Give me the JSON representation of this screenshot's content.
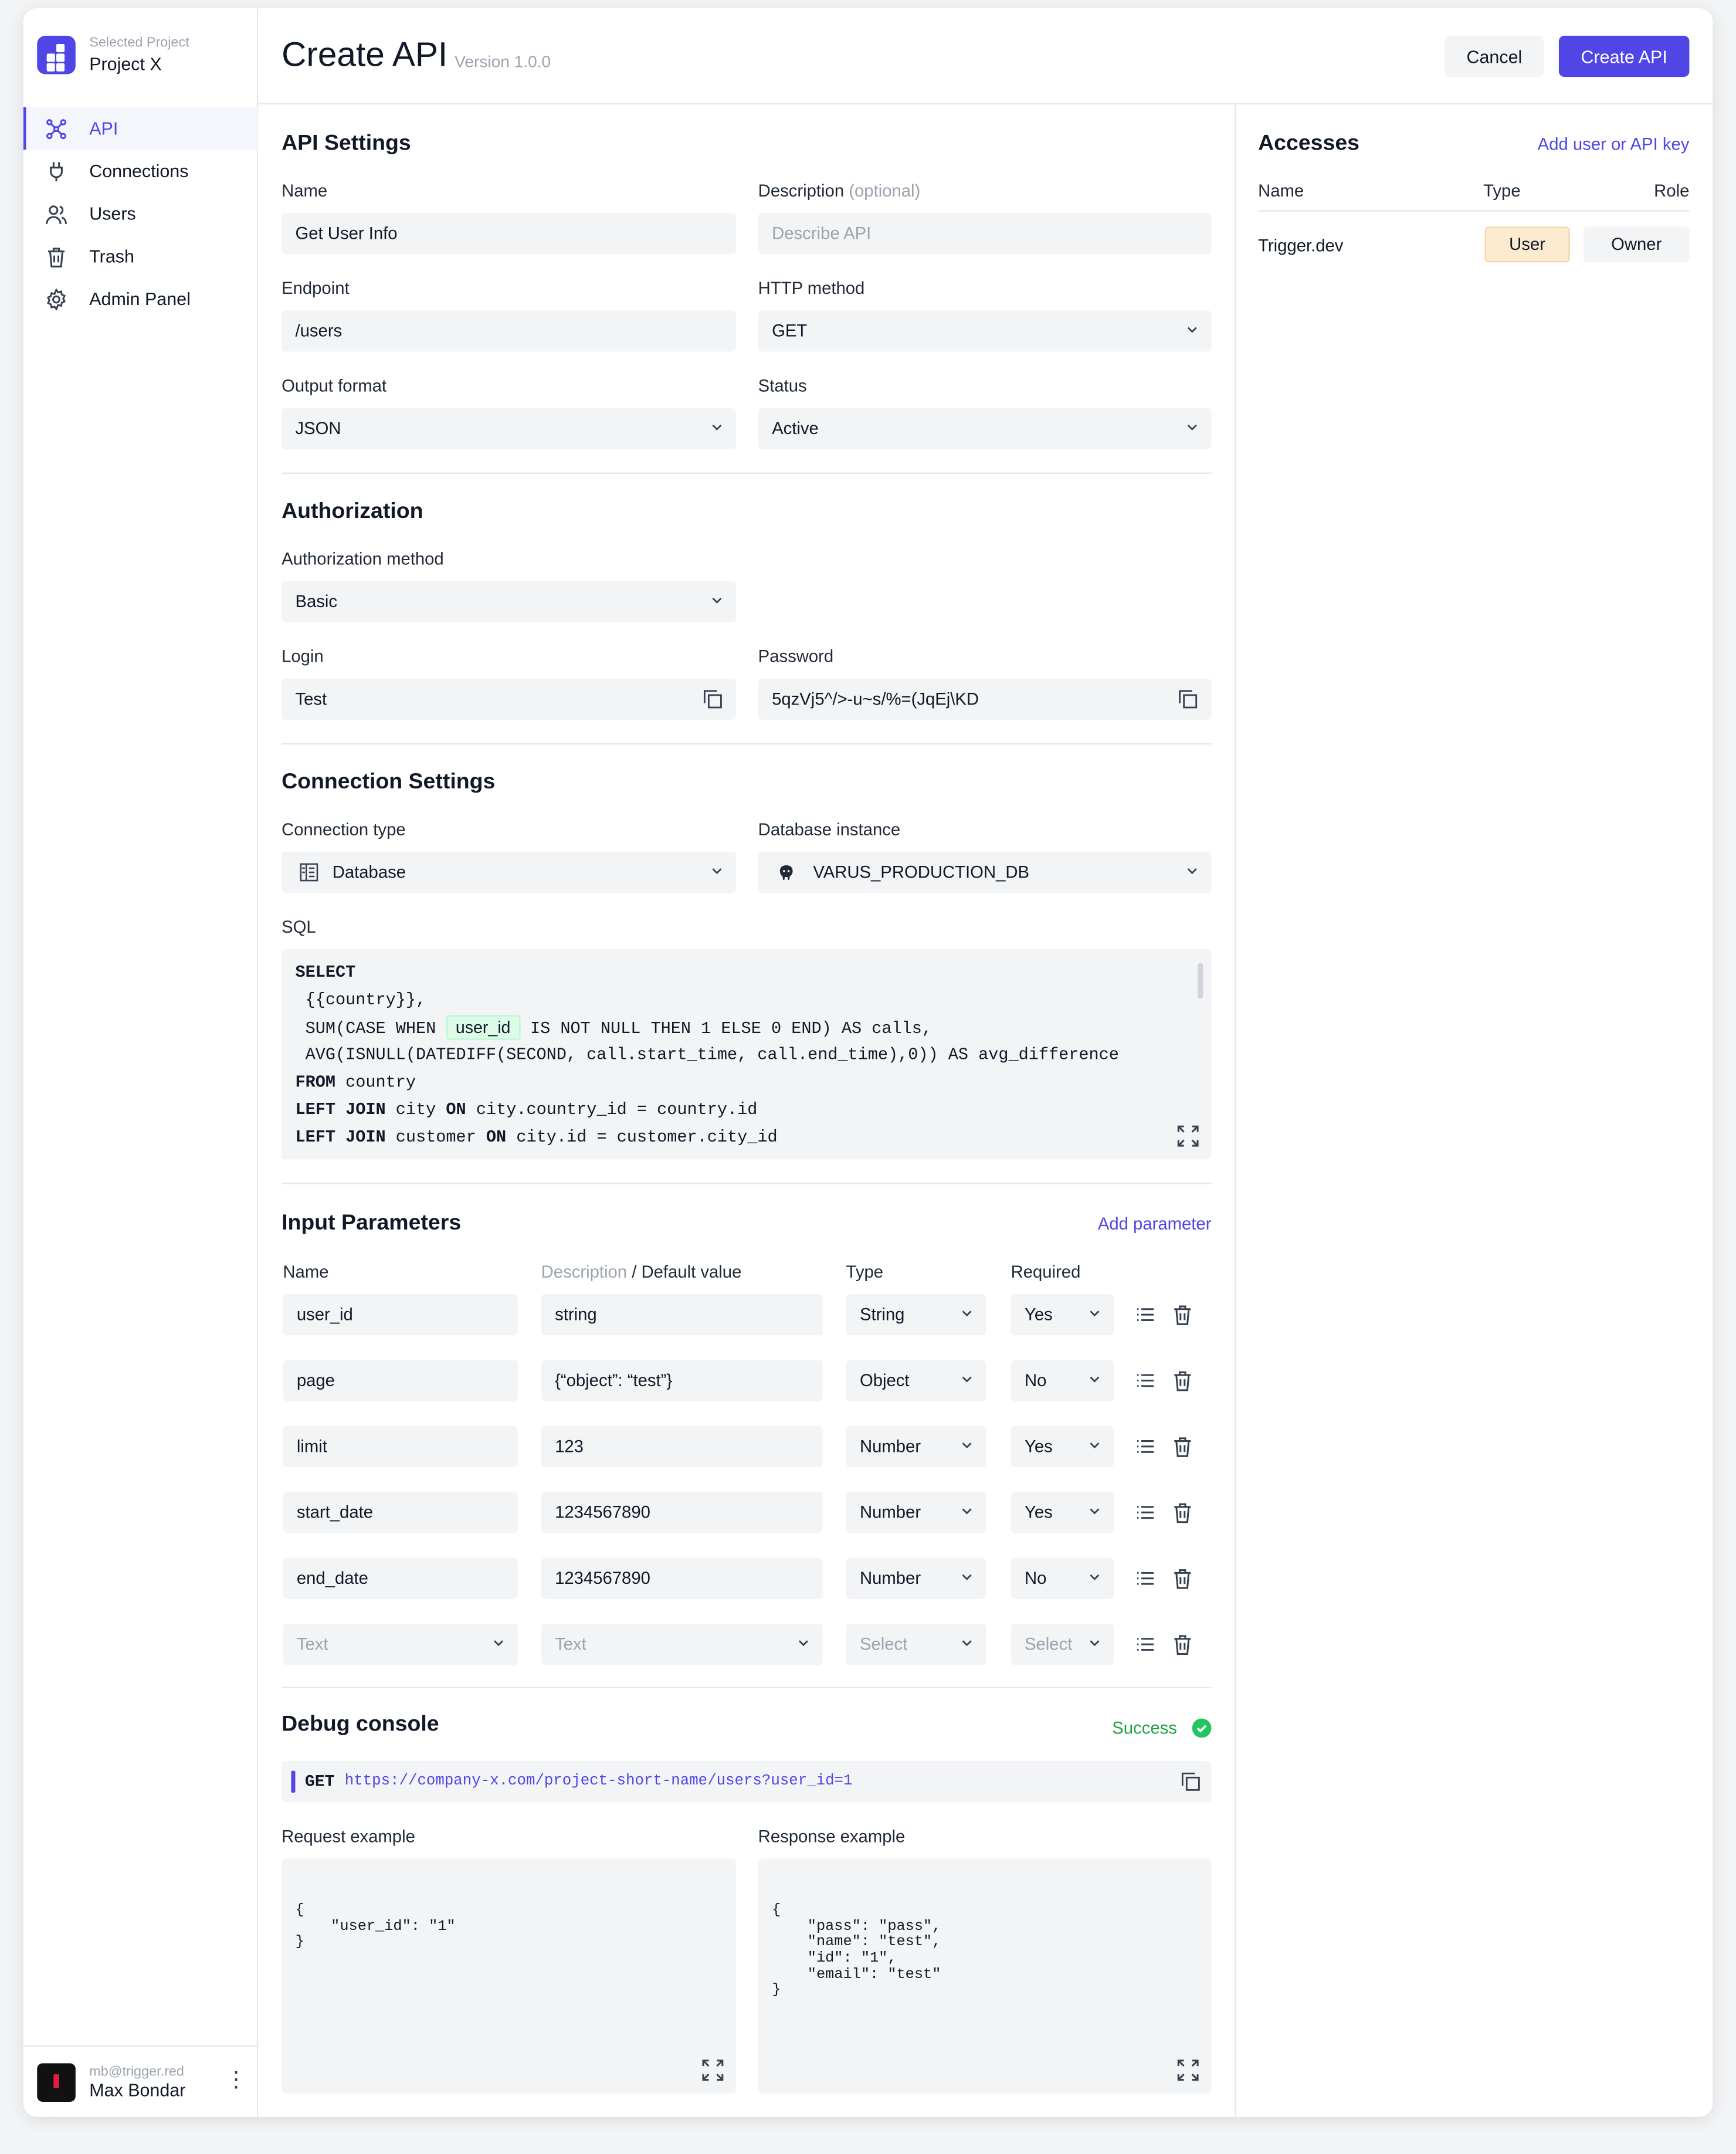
{
  "project": {
    "caption": "Selected Project",
    "name": "Project X"
  },
  "nav": [
    {
      "label": "API",
      "icon": "api-icon",
      "active": true
    },
    {
      "label": "Connections",
      "icon": "plug-icon"
    },
    {
      "label": "Users",
      "icon": "users-icon"
    },
    {
      "label": "Trash",
      "icon": "trash-icon"
    },
    {
      "label": "Admin Panel",
      "icon": "gear-icon"
    }
  ],
  "user": {
    "email": "mb@trigger.red",
    "name": "Max Bondar"
  },
  "header": {
    "title": "Create API",
    "version": "Version 1.0.0",
    "cancel": "Cancel",
    "create": "Create API"
  },
  "api_settings": {
    "title": "API Settings",
    "name_label": "Name",
    "name_value": "Get User Info",
    "desc_label": "Description",
    "desc_optional": "(optional)",
    "desc_placeholder": "Describe API",
    "endpoint_label": "Endpoint",
    "endpoint_value": "/users",
    "method_label": "HTTP method",
    "method_value": "GET",
    "output_label": "Output format",
    "output_value": "JSON",
    "status_label": "Status",
    "status_value": "Active"
  },
  "authorization": {
    "title": "Authorization",
    "method_label": "Authorization method",
    "method_value": "Basic",
    "login_label": "Login",
    "login_value": "Test",
    "password_label": "Password",
    "password_value": "5qzVj5^/>-u~s/%=(JqEj\\KD"
  },
  "connection": {
    "title": "Connection Settings",
    "type_label": "Connection type",
    "type_value": "Database",
    "db_label": "Database instance",
    "db_value": "VARUS_PRODUCTION_DB",
    "sql_label": "SQL",
    "sql": {
      "l1_kw": "SELECT",
      "l2": " {{country}},",
      "l3_pre": " SUM(CASE WHEN ",
      "l3_param": "user_id",
      "l3_post": " IS NOT NULL THEN 1 ELSE 0 END) AS calls,",
      "l4": " AVG(ISNULL(DATEDIFF(SECOND, call.start_time, call.end_time),0)) AS avg_difference",
      "l5_kw": "FROM",
      "l5": " country",
      "l6_kw": "LEFT JOIN",
      "l6": " city ",
      "l6_kw2": "ON",
      "l6b": " city.country_id = country.id",
      "l7_kw": "LEFT JOIN",
      "l7": " customer ",
      "l7_kw2": "ON",
      "l7b": " city.id = customer.city_id"
    }
  },
  "params": {
    "title": "Input Parameters",
    "add": "Add parameter",
    "col_name": "Name",
    "col_desc": "Description",
    "col_default": " / Default value",
    "col_type": "Type",
    "col_required": "Required",
    "rows": [
      {
        "name": "user_id",
        "default": "string",
        "type": "String",
        "required": "Yes"
      },
      {
        "name": "page",
        "default": "{“object”: “test”}",
        "type": "Object",
        "required": "No"
      },
      {
        "name": "limit",
        "default": "123",
        "type": "Number",
        "required": "Yes"
      },
      {
        "name": "start_date",
        "default": "1234567890",
        "type": "Number",
        "required": "Yes"
      },
      {
        "name": "end_date",
        "default": "1234567890",
        "type": "Number",
        "required": "No"
      }
    ],
    "new_row": {
      "name": "Text",
      "default": "Text",
      "type": "Select",
      "required": "Select"
    }
  },
  "debug": {
    "title": "Debug console",
    "status": "Success",
    "method": "GET",
    "url": "https://company-x.com/project-short-name/users?user_id=1",
    "request_label": "Request example",
    "request": "{\n    \"user_id\": \"1\"\n}",
    "response_label": "Response example",
    "response": "{\n    \"pass\": \"pass\",\n    \"name\": \"test\",\n    \"id\": \"1\",\n    \"email\": \"test\"\n}"
  },
  "accesses": {
    "title": "Accesses",
    "add": "Add user or API key",
    "col_name": "Name",
    "col_type": "Type",
    "col_role": "Role",
    "rows": [
      {
        "name": "Trigger.dev",
        "type": "User",
        "role": "Owner"
      }
    ]
  },
  "colors": {
    "accent": "#4f46e5",
    "success": "#22c55e"
  }
}
